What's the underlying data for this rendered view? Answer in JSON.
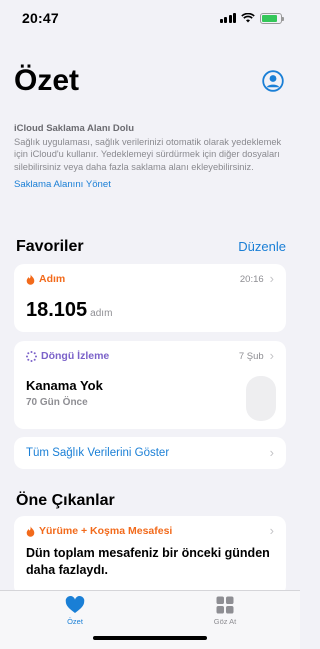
{
  "status": {
    "time": "20:47"
  },
  "header": {
    "title": "Özet"
  },
  "icloud": {
    "title": "iCloud Saklama Alanı Dolu",
    "body": "Sağlık uygulaması, sağlık verilerinizi otomatik olarak yedeklemek için iCloud'u kullanır. Yedeklemeyi sürdürmek için diğer dosyaları silebilirsiniz veya daha fazla saklama alanı ekleyebilirsiniz.",
    "link": "Saklama Alanını Yönet"
  },
  "favorites": {
    "title": "Favoriler",
    "edit": "Düzenle",
    "steps": {
      "label": "Adım",
      "time": "20:16",
      "value": "18.105",
      "unit": "adım"
    },
    "cycle": {
      "label": "Döngü İzleme",
      "date": "7 Şub",
      "status": "Kanama Yok",
      "ago": "70 Gün Önce"
    },
    "show_all": "Tüm Sağlık Verilerini Göster"
  },
  "highlights": {
    "title": "Öne Çıkanlar",
    "card": {
      "label": "Yürüme + Koşma Mesafesi",
      "text": "Dün toplam mesafeniz bir önceki günden daha fazlaydı."
    }
  },
  "tabs": [
    {
      "label": "Özet",
      "active": true
    },
    {
      "label": "Göz At",
      "active": false
    }
  ],
  "colors": {
    "accent": "#1a7fd6",
    "steps": "#f26a1b",
    "cycle": "#7b62c9",
    "battery": "#34c759"
  }
}
